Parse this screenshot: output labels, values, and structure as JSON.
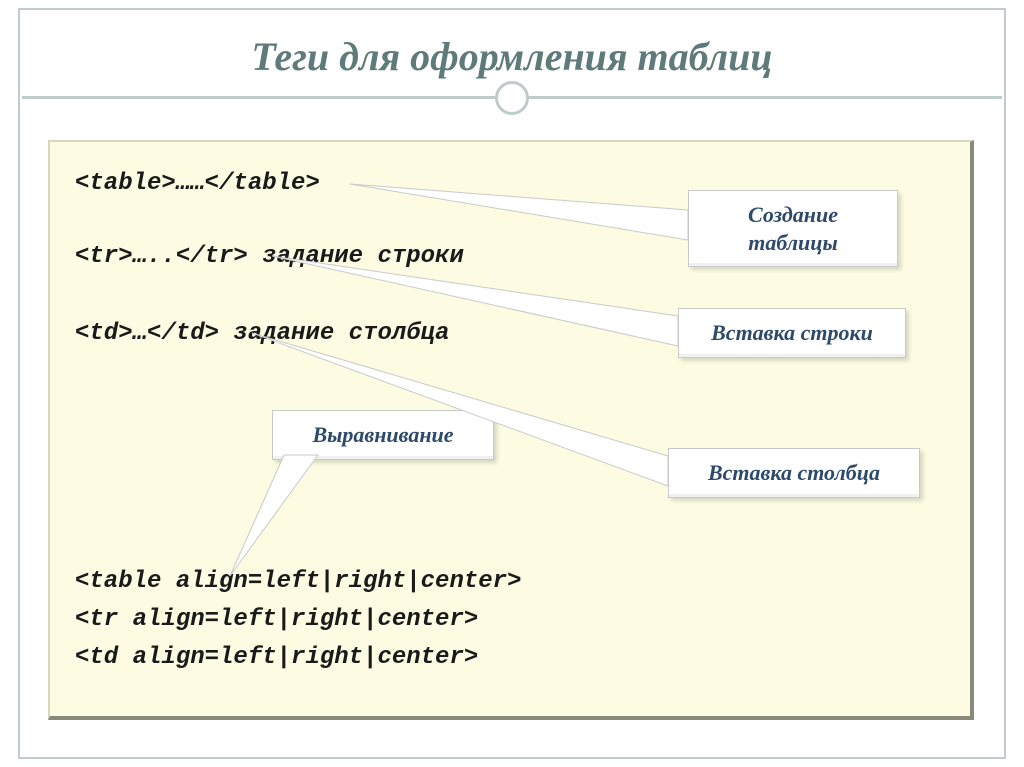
{
  "title": "Теги для оформления таблиц",
  "code": {
    "line1": "<table>……</table>",
    "line2": "<tr>…..</tr> задание строки",
    "line3": "<td>…</td> задание столбца",
    "line4": "<table align=left|right|center>",
    "line5": "<tr align=left|right|center>",
    "line6": "<td align=left|right|center>"
  },
  "callouts": {
    "create": "Создание\nтаблицы",
    "row": "Вставка строки",
    "col": "Вставка столбца",
    "align": "Выравнивание"
  }
}
